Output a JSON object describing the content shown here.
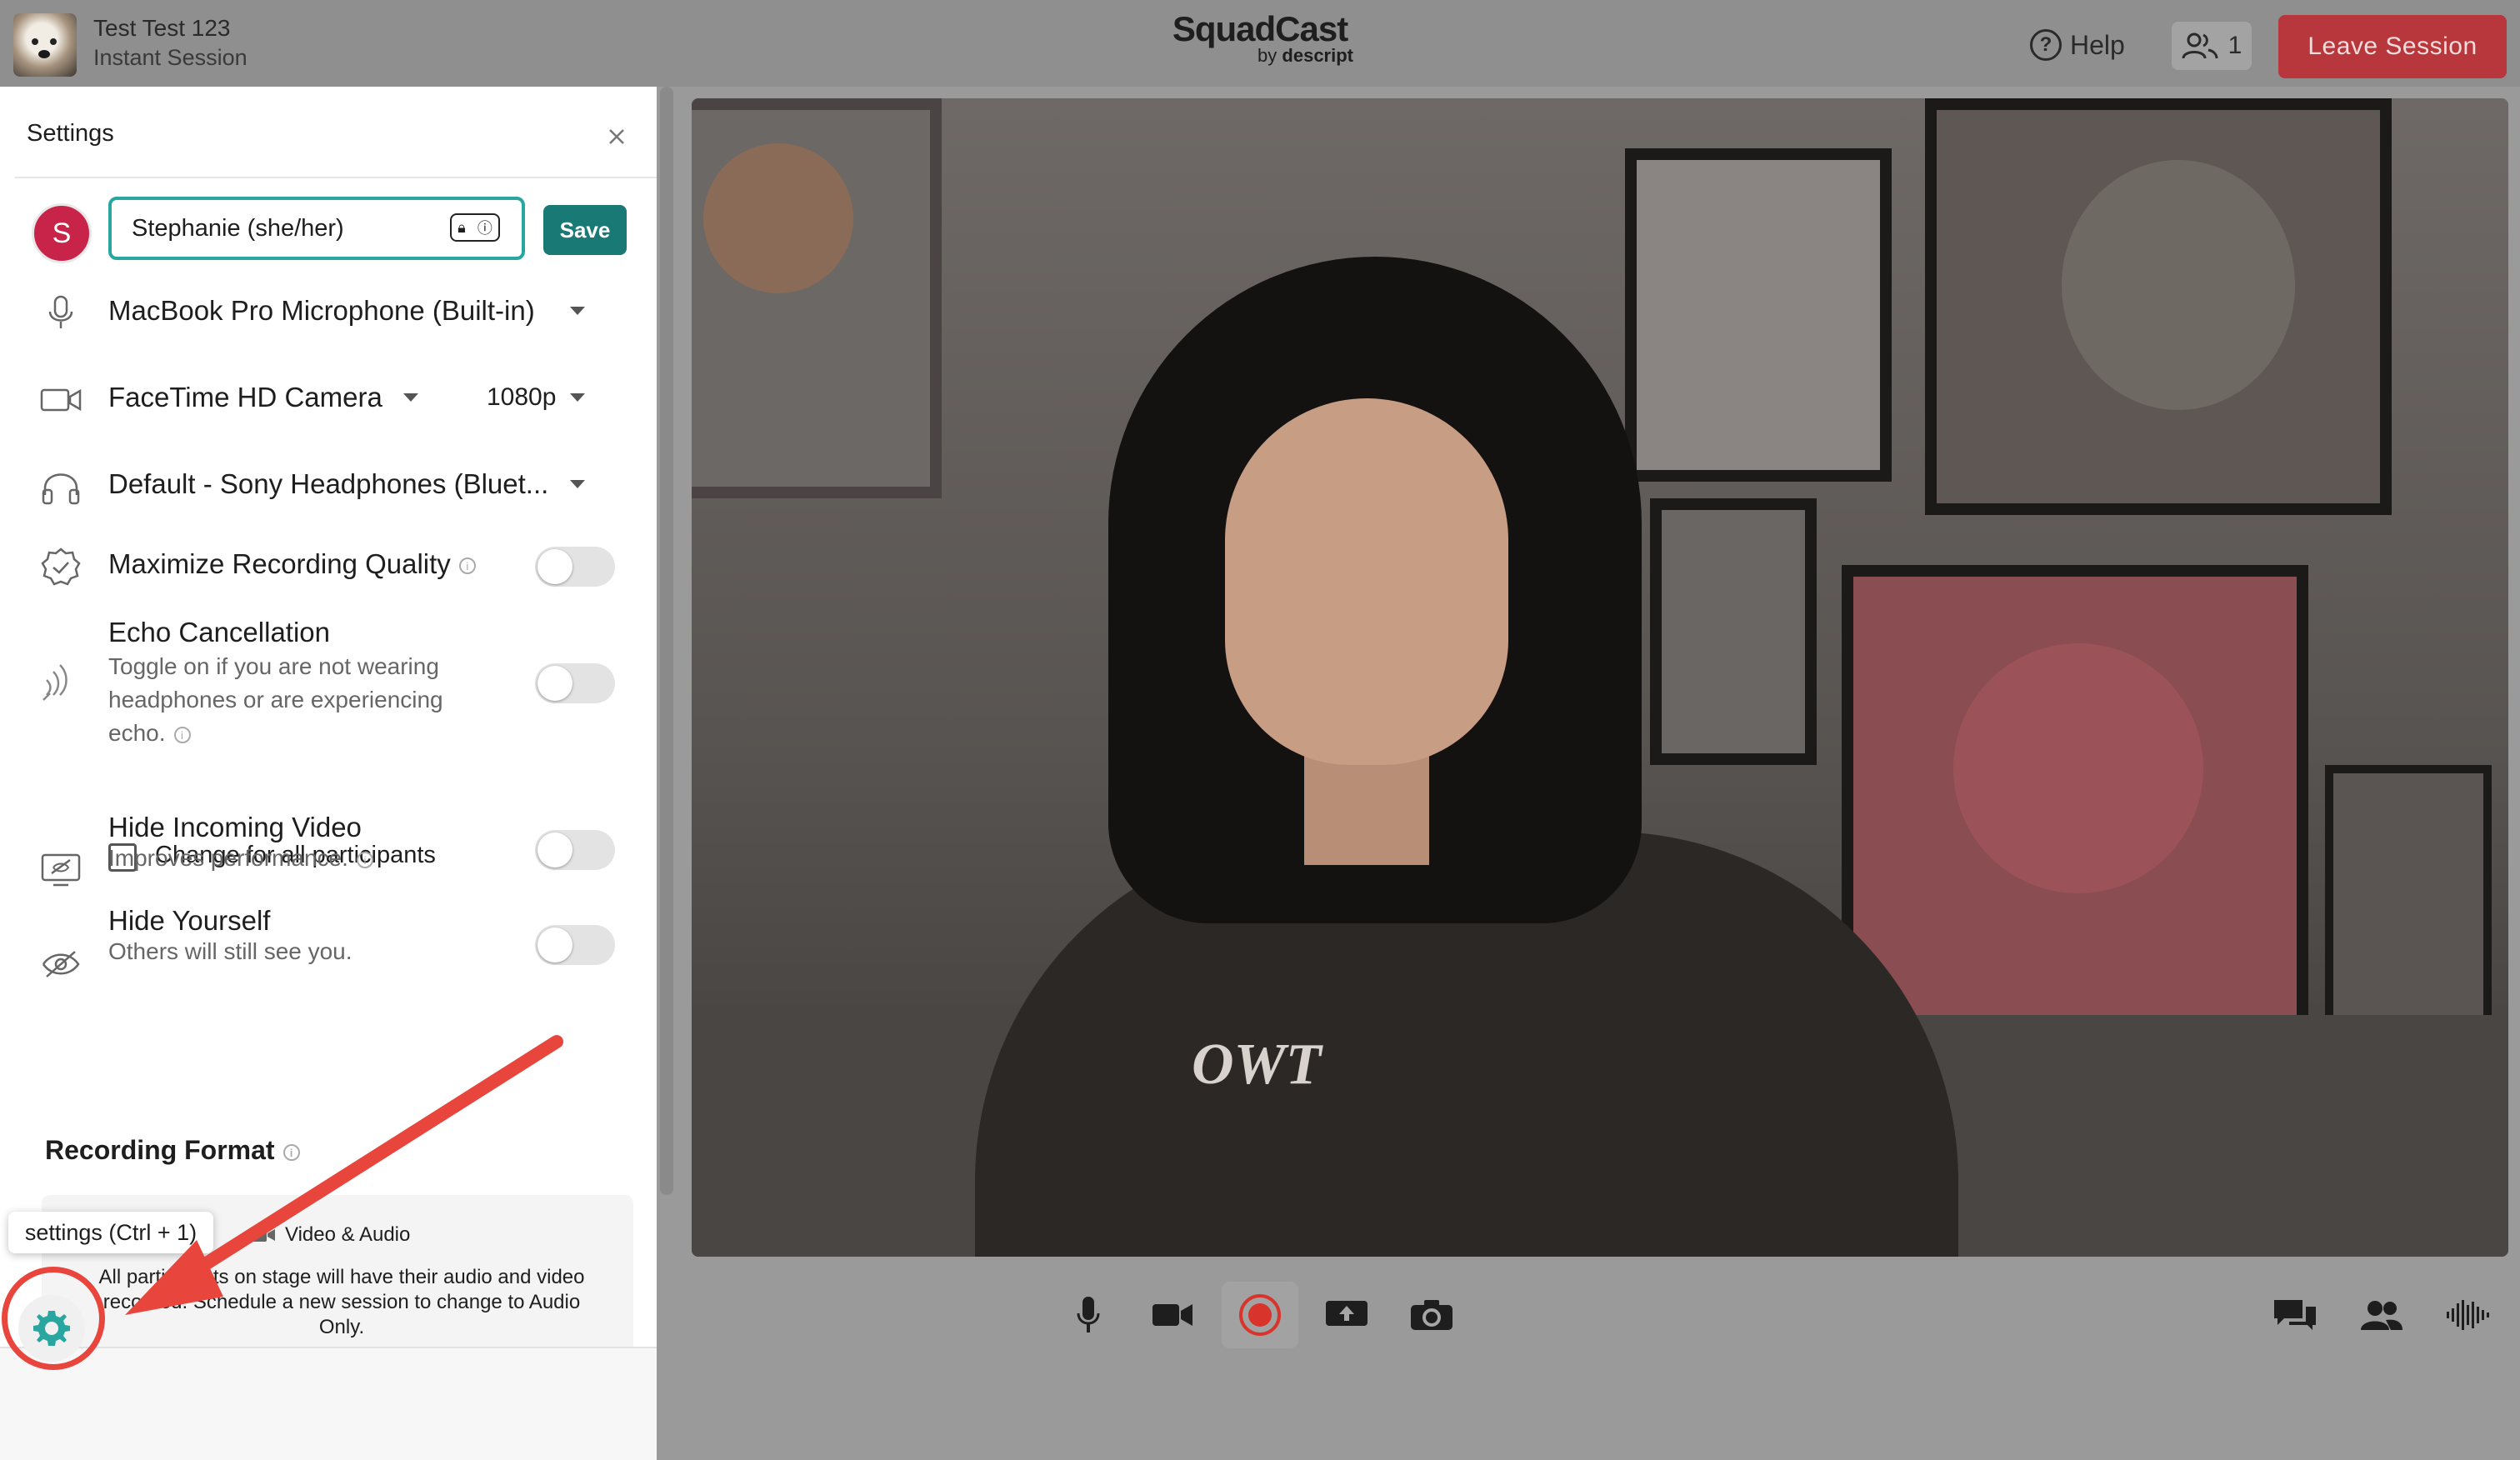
{
  "session": {
    "user": "Test Test 123",
    "type": "Instant Session"
  },
  "brand": {
    "name": "SquadCast",
    "by": "by",
    "company": "descript"
  },
  "header": {
    "help_label": "Help",
    "participant_count": "1",
    "leave_label": "Leave Session"
  },
  "settings": {
    "title": "Settings",
    "avatar_initial": "S",
    "name_value": "Stephanie (she/her)",
    "save_label": "Save",
    "microphone": "MacBook Pro Microphone (Built-in)",
    "camera": "FaceTime HD Camera",
    "resolution": "1080p",
    "speaker": "Default - Sony Headphones (Bluet...",
    "maximize_quality": {
      "label": "Maximize Recording Quality",
      "enabled": false
    },
    "echo_cancellation": {
      "label": "Echo Cancellation",
      "desc_line1": "Toggle on if you are not wearing",
      "desc_line2": "headphones or are experiencing",
      "desc_line3": "echo.",
      "enabled": false
    },
    "change_all_label": "Change for all participants",
    "hide_incoming": {
      "label": "Hide Incoming Video",
      "desc": "Improves performance.",
      "enabled": false
    },
    "hide_yourself": {
      "label": "Hide Yourself",
      "desc": "Others will still see you.",
      "enabled": false
    },
    "recording_format": {
      "title": "Recording Format",
      "option": "Video & Audio",
      "desc_line1": "All participants on stage will have their audio and video",
      "desc_line2": "recorded. Schedule a new session to change to Audio",
      "desc_line3": "Only."
    }
  },
  "tooltip": "settings (Ctrl + 1)",
  "video": {
    "shirt_text": "OWT"
  },
  "colors": {
    "accent": "#2aa6a1",
    "save": "#197a75",
    "leave": "#b7373c",
    "avatar": "#c8244a",
    "annotation": "#e8453c",
    "record": "#d9342b"
  },
  "icons": [
    "microphone-icon",
    "camera-icon",
    "headphones-icon",
    "quality-badge-icon",
    "echo-icon",
    "hide-video-icon",
    "hide-eye-icon",
    "gear-icon",
    "record-icon",
    "share-screen-icon",
    "snapshot-icon",
    "chat-icon",
    "people-icon",
    "audio-wave-icon",
    "help-icon",
    "participants-icon",
    "close-icon",
    "password-manager-icon"
  ]
}
